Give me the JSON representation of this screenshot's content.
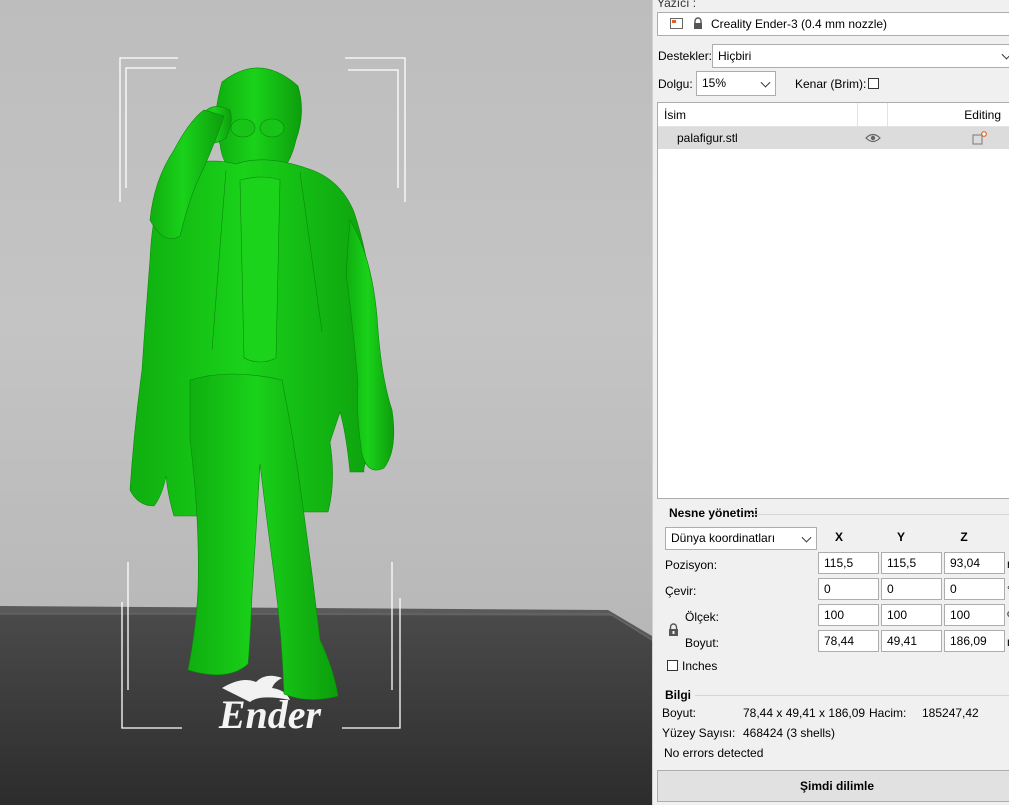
{
  "printer": {
    "section_label": "Yazıcı :",
    "name": "Creality Ender-3 (0.4 mm nozzle)"
  },
  "supports": {
    "label": "Destekler:",
    "value": "Hiçbiri"
  },
  "infill": {
    "label": "Dolgu:",
    "value": "15%"
  },
  "brim": {
    "label": "Kenar (Brim):",
    "checked": false
  },
  "object_list": {
    "columns": [
      "İsim",
      "",
      "Editing"
    ],
    "items": [
      {
        "name": "palafigur.stl",
        "visible_icon": "eye-icon",
        "edit_icon": "edit-object-icon"
      }
    ]
  },
  "object_manipulation": {
    "title": "Nesne yönetimi",
    "coordinate_system": "Dünya koordinatları",
    "axes": [
      "X",
      "Y",
      "Z"
    ],
    "rows": [
      {
        "label": "Pozisyon:",
        "x": "115,5",
        "y": "115,5",
        "z": "93,04",
        "unit": "m"
      },
      {
        "label": "Çevir:",
        "x": "0",
        "y": "0",
        "z": "0",
        "unit": "°"
      },
      {
        "label": "Ölçek:",
        "x": "100",
        "y": "100",
        "z": "100",
        "unit": "%"
      },
      {
        "label": "Boyut:",
        "x": "78,44",
        "y": "49,41",
        "z": "186,09",
        "unit": "m"
      }
    ],
    "lock_icon": "lock-icon",
    "inches_label": "Inches",
    "inches_checked": false
  },
  "info": {
    "title": "Bilgi",
    "size_label": "Boyut:",
    "size_value": "78,44 x 49,41 x 186,09",
    "volume_label": "Hacim:",
    "volume_value": "185247,42",
    "facets_label": "Yüzey Sayısı:",
    "facets_value": "468424 (3 shells)",
    "errors": "No errors detected"
  },
  "slice_button": "Şimdi dilimle",
  "viewport": {
    "bed_logo_text": "Ender",
    "model_color": "#11cc11",
    "bed_color": "#3a3a3a"
  }
}
